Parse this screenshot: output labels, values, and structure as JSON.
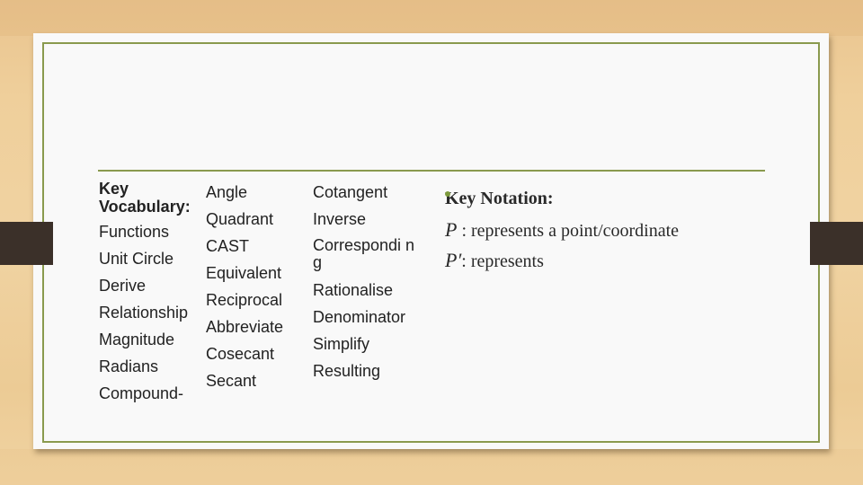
{
  "slide": {
    "vocabulary": {
      "heading_line1": "Key",
      "heading_line2": "Vocabulary:",
      "column1": [
        "Functions",
        "Unit Circle",
        "Derive",
        "Relationship",
        "Magnitude",
        "Radians",
        "Compound-"
      ],
      "column2": [
        "Angle",
        "Quadrant",
        "CAST",
        "Equivalent",
        "Reciprocal",
        "Abbreviate",
        "Cosecant",
        "Secant"
      ],
      "column3": [
        "Cotangent",
        "Inverse",
        "Correspondi ng",
        "Rationalise",
        "Denominator",
        "Simplify",
        "Resulting"
      ]
    },
    "notation": {
      "title": "Key Notation:",
      "items": [
        {
          "symbol": "P",
          "text": " : represents a point/coordinate"
        },
        {
          "symbol": "P′",
          "text": ": represents"
        }
      ]
    },
    "colors": {
      "accent_green": "#8a9a4e",
      "tab_dark": "#3b3029",
      "background_wood": "#efcf9b"
    }
  }
}
